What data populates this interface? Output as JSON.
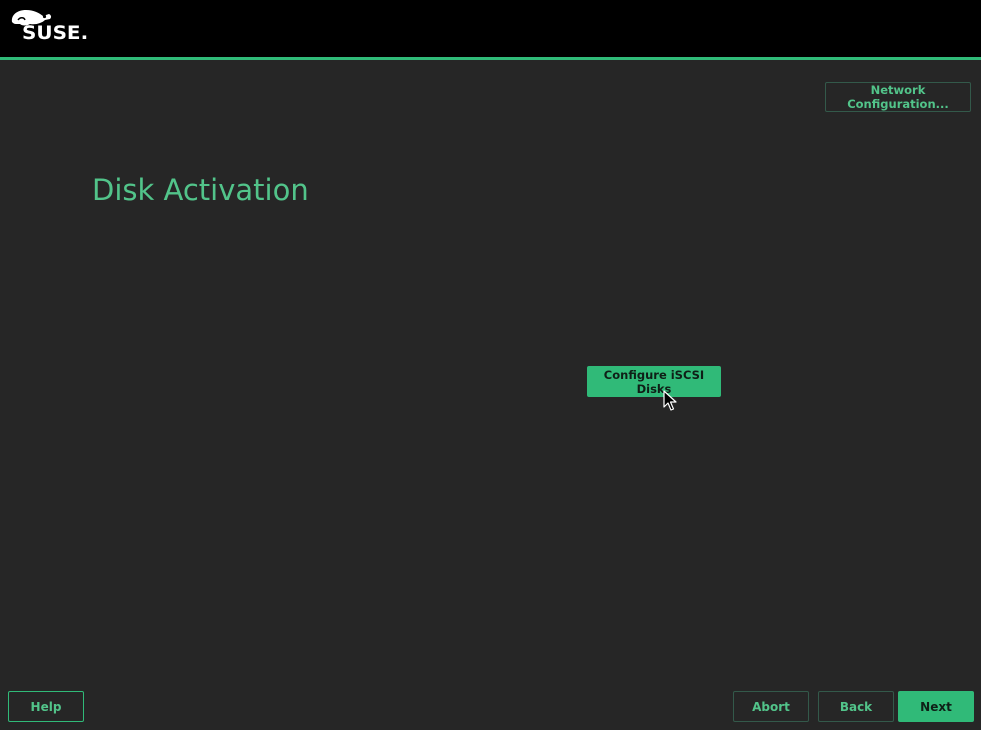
{
  "header": {
    "logo_text": "SUSE.",
    "accent_color": "#30ba78"
  },
  "toolbar": {
    "network_configuration_label": "Network Configuration..."
  },
  "main": {
    "title": "Disk Activation",
    "configure_iscsi_label": "Configure iSCSI Disks"
  },
  "footer": {
    "help_label": "Help",
    "abort_label": "Abort",
    "back_label": "Back",
    "next_label": "Next"
  },
  "icons": {
    "logo": "suse-chameleon-icon",
    "cursor": "mouse-pointer-icon"
  }
}
